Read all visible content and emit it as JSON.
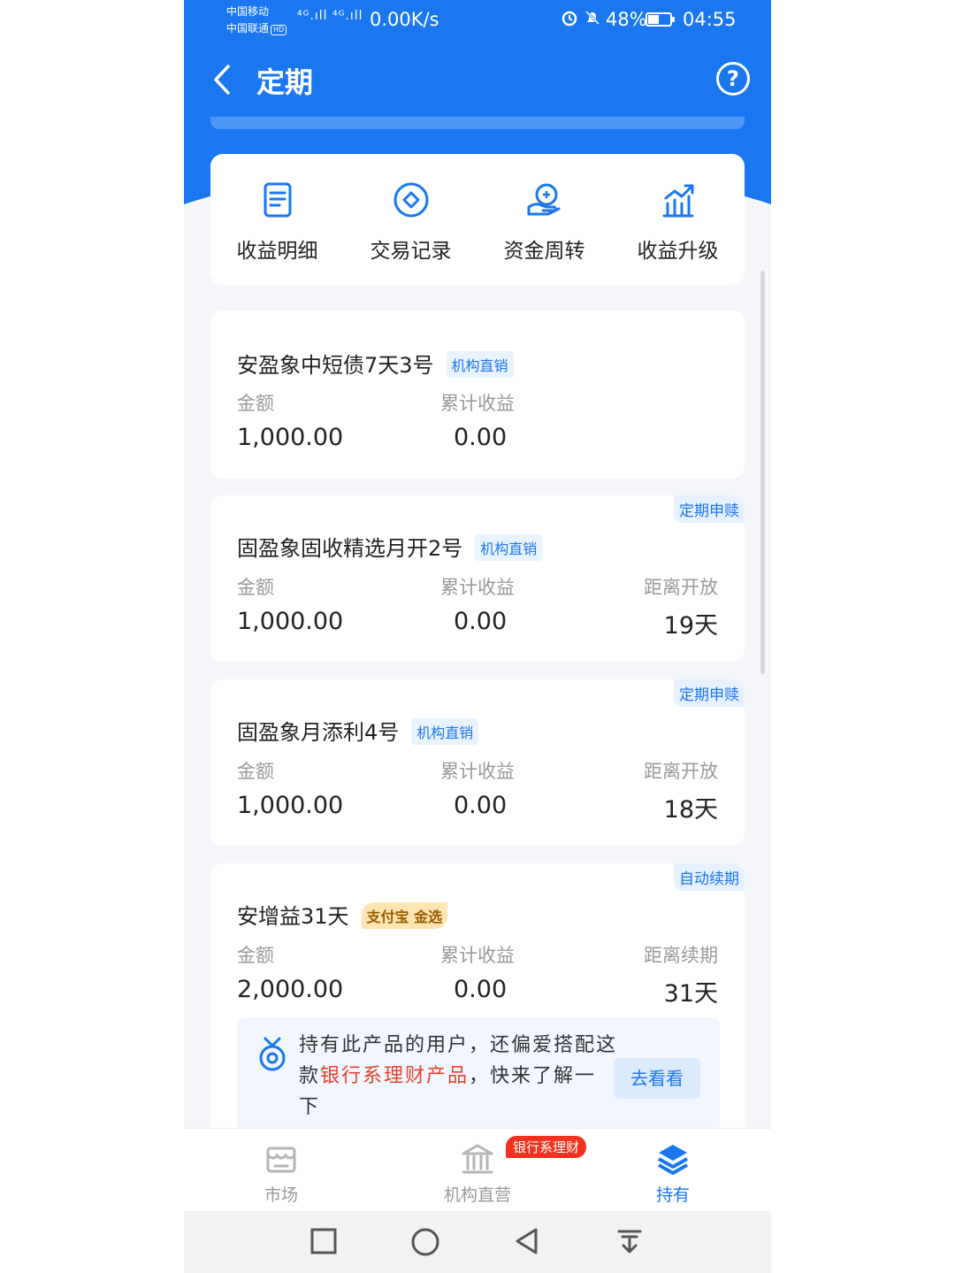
{
  "status_bar": {
    "carrier1": "中国移动",
    "carrier2": "中国联通",
    "hd": "HD",
    "signal": "⁴ᴳ.ıll ⁴ᴳ.ıll",
    "net_speed": "0.00K/s",
    "battery": "48%",
    "battery_level": 0.48,
    "time": "04:55"
  },
  "header": {
    "title": "定期",
    "help": "?"
  },
  "actions": [
    {
      "label": "收益明细",
      "icon": "document-icon"
    },
    {
      "label": "交易记录",
      "icon": "diamond-coin-icon"
    },
    {
      "label": "资金周转",
      "icon": "hand-coin-icon"
    },
    {
      "label": "收益升级",
      "icon": "bar-chart-up-icon"
    }
  ],
  "products": [
    {
      "name": "安盈象中短债7天3号",
      "badge": "机构直销",
      "corner_tag": "",
      "amount_label": "金额",
      "amount": "1,000.00",
      "income_label": "累计收益",
      "income": "0.00",
      "extra_label": "",
      "extra": ""
    },
    {
      "name": "固盈象固收精选月开2号",
      "badge": "机构直销",
      "corner_tag": "定期申赎",
      "amount_label": "金额",
      "amount": "1,000.00",
      "income_label": "累计收益",
      "income": "0.00",
      "extra_label": "距离开放",
      "extra": "19天"
    },
    {
      "name": "固盈象月添利4号",
      "badge": "机构直销",
      "corner_tag": "定期申赎",
      "amount_label": "金额",
      "amount": "1,000.00",
      "income_label": "累计收益",
      "income": "0.00",
      "extra_label": "距离开放",
      "extra": "18天"
    },
    {
      "name": "安增益31天",
      "badge": "支付宝 金选",
      "corner_tag": "自动续期",
      "amount_label": "金额",
      "amount": "2,000.00",
      "income_label": "累计收益",
      "income": "0.00",
      "extra_label": "距离续期",
      "extra": "31天"
    }
  ],
  "promo": {
    "text_before": "持有此产品的用户，还偏爱搭配这款",
    "highlight": "银行系理财产品",
    "text_after": "，快来了解一下",
    "button": "去看看"
  },
  "tabs": [
    {
      "label": "市场",
      "icon": "market-icon",
      "active": false
    },
    {
      "label": "机构直营",
      "icon": "bank-icon",
      "active": false
    },
    {
      "label": "持有",
      "icon": "layers-icon",
      "active": true
    }
  ],
  "tab_badge": "银行系理财",
  "colors": {
    "primary": "#1a77f0",
    "highlight": "#e5422d",
    "badge_red": "#f2311e",
    "gold_badge": "#fde6b4"
  }
}
